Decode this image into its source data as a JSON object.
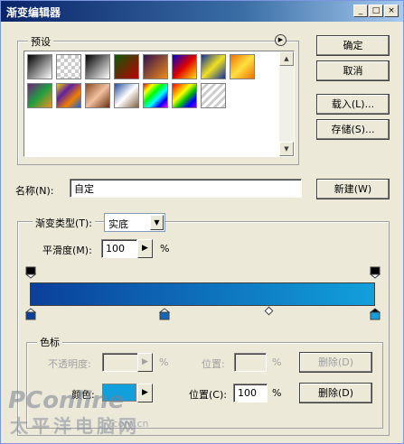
{
  "window": {
    "title": "渐变编辑器",
    "minimize_label": "_",
    "maximize_label": "□",
    "close_label": "×"
  },
  "presets": {
    "label": "预设",
    "menu_icon": "circle-arrow-right-icon",
    "swatches": [
      {
        "name": "black-white-foreground",
        "gradient": "linear-gradient(135deg,#000,#fff)"
      },
      {
        "name": "transparent",
        "gradient": "repeating-conic-gradient(#ccc 0% 25%, #fff 0% 50%) 0 0/8px 8px"
      },
      {
        "name": "black-to-white",
        "gradient": "linear-gradient(135deg,#000,#fff)"
      },
      {
        "name": "red-green",
        "gradient": "linear-gradient(135deg,#0a5a0a,#c00000)"
      },
      {
        "name": "violet-orange",
        "gradient": "linear-gradient(135deg,#30104e,#f08a1a)"
      },
      {
        "name": "blue-red-yellow",
        "gradient": "linear-gradient(135deg,#0000d0,#e00000,#ffe000)"
      },
      {
        "name": "blue-yellow-blue",
        "gradient": "linear-gradient(135deg,#1030a0,#f0e020,#1030a0)"
      },
      {
        "name": "orange-yellow-orange",
        "gradient": "linear-gradient(135deg,#f07000,#ffe040,#f07000)"
      },
      {
        "name": "violet-green-orange",
        "gradient": "linear-gradient(135deg,#702080,#20a040,#f09020)"
      },
      {
        "name": "yellow-violet-orange-blue",
        "gradient": "linear-gradient(135deg,#f0d000,#6020a0,#f08000,#2060d0)"
      },
      {
        "name": "copper",
        "gradient": "linear-gradient(135deg,#8a4a20,#f0c0a0,#6a3010)"
      },
      {
        "name": "chrome",
        "gradient": "linear-gradient(135deg,#2050a0,#fff,#806040)"
      },
      {
        "name": "spectrum",
        "gradient": "linear-gradient(135deg,#ff0000,#ffff00,#00ff00,#00ffff,#0000ff,#ff00ff)"
      },
      {
        "name": "transparent-rainbow",
        "gradient": "linear-gradient(135deg,#ff0000,#ff8000,#ffff00,#00c000,#0000ff,#8000ff)"
      },
      {
        "name": "transparent-stripes",
        "gradient": "repeating-linear-gradient(135deg,#fff 0 3px,#ccc 3px 6px)"
      }
    ]
  },
  "buttons": {
    "ok": "确定",
    "cancel": "取消",
    "load": "载入(L)...",
    "save": "存储(S)...",
    "new": "新建(W)"
  },
  "name_field": {
    "label": "名称(N):",
    "value": "自定"
  },
  "gradient": {
    "type_label": "渐变类型(T):",
    "type_value": "实底",
    "smoothness_label": "平滑度(M):",
    "smoothness_value": "100",
    "smoothness_unit": "%",
    "start_color": "#0B3F9A",
    "end_color": "#11A0DB"
  },
  "color_stops": {
    "group_label": "色标",
    "opacity_label": "不透明度:",
    "opacity_unit": "%",
    "opacity_location_label": "位置:",
    "opacity_location_unit": "%",
    "opacity_delete": "删除(D)",
    "color_label": "颜色:",
    "color_value": "#11A0DB",
    "color_location_label": "位置(C):",
    "color_location_value": "100",
    "color_location_unit": "%",
    "color_delete": "删除(D)"
  },
  "watermark": {
    "brand": "PConline",
    "chinese": "太平洋电脑网",
    "url": ".com.cn"
  }
}
